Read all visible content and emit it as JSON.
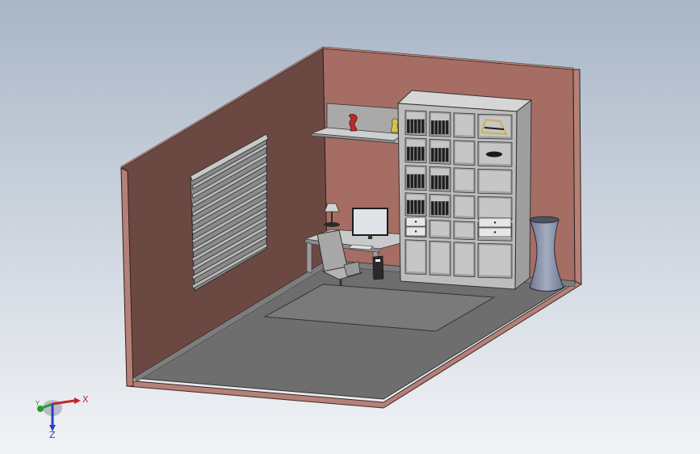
{
  "viewport": {
    "background_top": "#a9b6c7",
    "background_bottom": "#f1f3f6",
    "view_type": "isometric",
    "display_style": "shaded-with-edges"
  },
  "model": {
    "room": {
      "back_wall_color": "#a56d63",
      "left_wall_color": "#6b4942",
      "floor_color": "#6e6e6e",
      "wall_edge_color": "#b48077"
    },
    "furniture": [
      "window-blinds",
      "wall-shelf",
      "vase-red",
      "vase-yellow",
      "bookcase",
      "books",
      "storage-basket",
      "drawer-boxes",
      "desk",
      "desk-lamp",
      "monitor",
      "office-chair",
      "pc-tower",
      "floor-rug",
      "floor-vase"
    ],
    "accent_colors": {
      "red_vase": "#c0282a",
      "yellow_vase": "#d6c24a",
      "basket": "#c8b35a",
      "floor_vase": "#8a93a6"
    }
  },
  "triad": {
    "x_label": "X",
    "y_label": "Y",
    "z_label": "Z",
    "x_color": "#c0282a",
    "y_color": "#2a9a2a",
    "z_color": "#2a3fbf"
  }
}
